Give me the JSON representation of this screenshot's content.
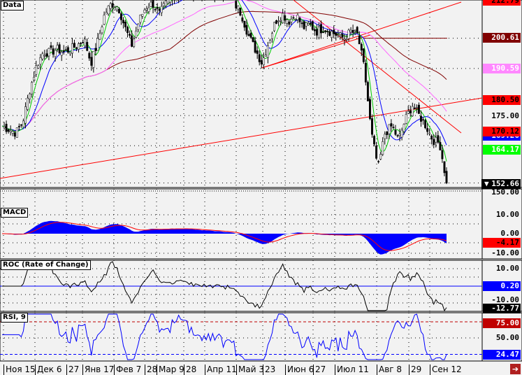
{
  "panels": {
    "price": "Data",
    "macd": "MACD",
    "roc": "ROC (Rate of Change)",
    "rsi": "RSI, 9"
  },
  "price_labels": {
    "top": "212.79",
    "sma_long": "200.61",
    "sma_mid": "190.59",
    "trend": "180.50",
    "tick175": "175.00",
    "sma_short": "170.12",
    "last_ma": "169.26",
    "ma_fast": "164.17",
    "last": "152.66",
    "tick150": "150.00"
  },
  "macd_labels": {
    "t10": "10.00",
    "t0": "0.00",
    "val": "-4.17",
    "tm10": "-10.00"
  },
  "roc_labels": {
    "t10": "10.00",
    "val": "0.20",
    "tm10": "-10.00",
    "last": "-12.77"
  },
  "rsi_labels": {
    "t75": "75.00",
    "t50": "50.00",
    "val": "24.47"
  },
  "dates": [
    "Ноя 15",
    "Дек 6",
    "27",
    "Янв 17",
    "Фев 7",
    "28",
    "Мар 9",
    "28",
    "Апр 11",
    "Май 3",
    "23",
    "Июн 6",
    "27",
    "Июл 11",
    "Авг 8",
    "29",
    "Сен 12"
  ],
  "colors": {
    "bg": "#f2f2f2",
    "up": "#ffffff",
    "down": "#000000",
    "ma1": "#00cc00",
    "ma2": "#0000ff",
    "ma3": "#ff66ff",
    "ma4": "#800000",
    "trend": "#ff0000",
    "macd": "#0000ff"
  },
  "chart_data": {
    "type": "candlestick",
    "title": "Data",
    "ylim": [
      150,
      212.79
    ],
    "close_keypoints": [
      171.5,
      170.4,
      169.2,
      172.7,
      183.1,
      191.2,
      195.9,
      195.9,
      197.0,
      195.9,
      197.0,
      198.2,
      200.5,
      192.4,
      199.4,
      208.6,
      212.1,
      210.9,
      204.0,
      198.2,
      206.3,
      210.9,
      212.1,
      208.6,
      212.1,
      214.4,
      215.6,
      215.6,
      215.6,
      215.6,
      215.6,
      215.6,
      215.6,
      215.6,
      212.1,
      208.6,
      201.7,
      197.0,
      192.4,
      199.4,
      206.3,
      208.6,
      206.3,
      208.6,
      204.0,
      205.1,
      202.8,
      204.0,
      202.8,
      201.7,
      200.5,
      202.8,
      201.7,
      190.1,
      169.2,
      157.6,
      169.2,
      171.5,
      166.9,
      173.8,
      178.5,
      175.0,
      171.5,
      166.9,
      165.8,
      153.0
    ],
    "indicators": {
      "macd_last": -4.17,
      "roc_last": -12.77,
      "roc_ref": 0.2,
      "rsi_last": 24.47,
      "rsi_levels": [
        75,
        24.47
      ]
    }
  }
}
